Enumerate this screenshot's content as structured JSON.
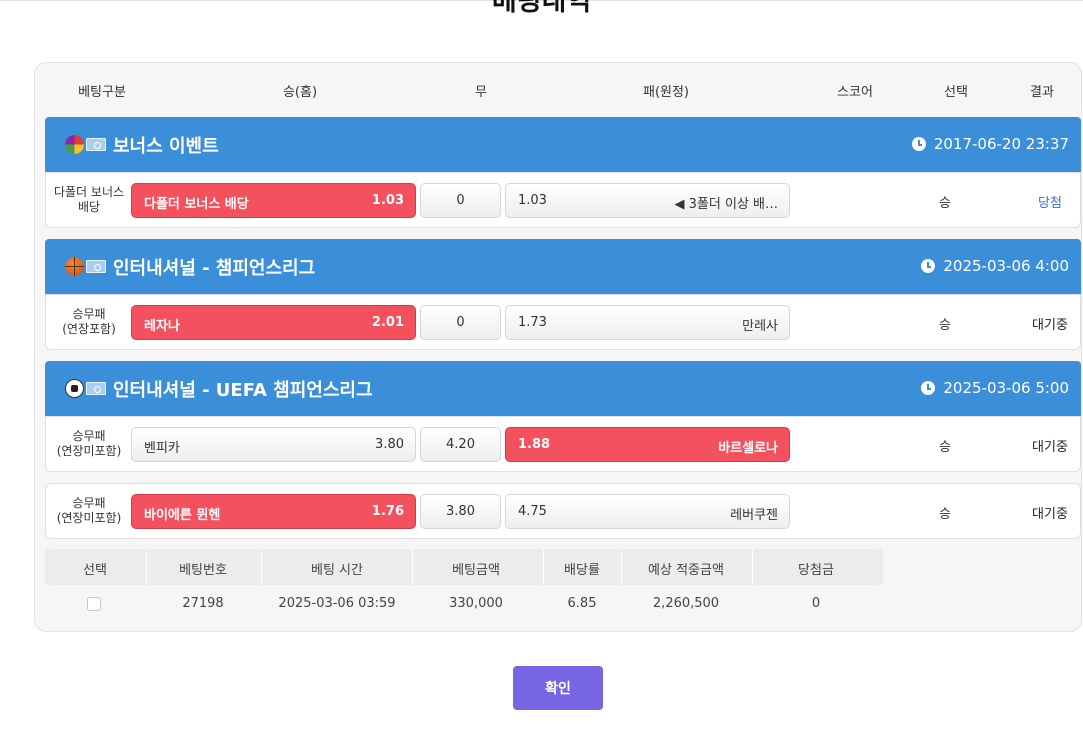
{
  "page_title": "베팅내역",
  "columns": [
    "베팅구분",
    "승(홈)",
    "무",
    "패(원정)",
    "스코어",
    "선택",
    "결과"
  ],
  "groups": [
    {
      "league": "보너스 이벤트",
      "sport_icon": "bonus-ball-icon",
      "time": "2017-06-20 23:37",
      "bet": {
        "type": "다폴더 보너스 배당",
        "home_label": "다폴더 보너스 배당",
        "home_odds": "1.03",
        "draw": "0",
        "away_odds": "1.03",
        "away_label": "◀ 3폴더 이상 배…",
        "selected": "home",
        "choice": "승",
        "result": "당첨"
      }
    },
    {
      "league": "인터내셔널 - 챔피언스리그",
      "sport_icon": "basketball-icon",
      "time": "2025-03-06 4:00",
      "bet": {
        "type": "승무패\n(연장포함)",
        "home_label": "레자나",
        "home_odds": "2.01",
        "draw": "0",
        "away_odds": "1.73",
        "away_label": "만레사",
        "selected": "home",
        "choice": "승",
        "result": "대기중"
      }
    },
    {
      "league": "인터내셔널 - UEFA 챔피언스리그",
      "sport_icon": "soccer-ball-icon",
      "time": "2025-03-06 5:00",
      "bets": [
        {
          "type": "승무패\n(연장미포함)",
          "home_label": "벤피카",
          "home_odds": "3.80",
          "draw": "4.20",
          "away_odds": "1.88",
          "away_label": "바르셀로나",
          "selected": "away",
          "choice": "승",
          "result": "대기중"
        },
        {
          "type": "승무패\n(연장미포함)",
          "home_label": "바이에른 뮌헨",
          "home_odds": "1.76",
          "draw": "3.80",
          "away_odds": "4.75",
          "away_label": "레버쿠젠",
          "selected": "home",
          "choice": "승",
          "result": "대기중"
        }
      ]
    }
  ],
  "summary": {
    "headers": [
      "선택",
      "베팅번호",
      "베팅 시간",
      "베팅금액",
      "배당률",
      "예상 적중금액",
      "당첨금"
    ],
    "row": {
      "bet_no": "27198",
      "time": "2025-03-06 03:59",
      "amount": "330,000",
      "odds": "6.85",
      "expected": "2,260,500",
      "prize": "0"
    }
  },
  "confirm_label": "확인",
  "colors": {
    "league_bar": "#3a8fd8",
    "selected_odds": "#f4515e",
    "confirm": "#7766e3",
    "win_text": "#3a6fd8"
  }
}
